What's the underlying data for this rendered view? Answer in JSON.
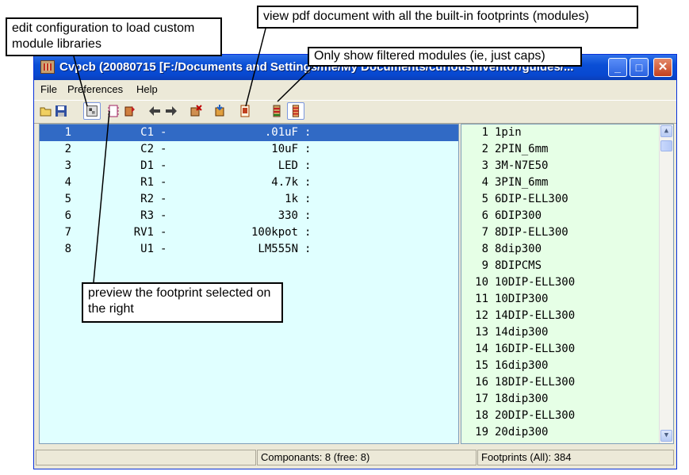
{
  "window": {
    "title": "Cvpcb (20080715 [F:/Documents and Settings/me/My Documents/curiousinventor/guides/..."
  },
  "menu": [
    "File",
    "Preferences",
    "Help"
  ],
  "toolbar": {
    "icons": [
      "open-icon",
      "save-icon",
      "config-icon",
      "preview-footprint-icon",
      "auto-associate-icon",
      "previous-icon",
      "next-icon",
      "delete-associations-icon",
      "export-icon",
      "pdf-doc-icon",
      "show-filtered-icon",
      "show-all-icon"
    ]
  },
  "components": [
    {
      "index": "1",
      "ref": "C1",
      "value": ".01uF",
      "selected": true
    },
    {
      "index": "2",
      "ref": "C2",
      "value": "10uF"
    },
    {
      "index": "3",
      "ref": "D1",
      "value": "LED"
    },
    {
      "index": "4",
      "ref": "R1",
      "value": "4.7k"
    },
    {
      "index": "5",
      "ref": "R2",
      "value": "1k"
    },
    {
      "index": "6",
      "ref": "R3",
      "value": "330"
    },
    {
      "index": "7",
      "ref": "RV1",
      "value": "100kpot"
    },
    {
      "index": "8",
      "ref": "U1",
      "value": "LM555N"
    }
  ],
  "footprints": [
    {
      "index": "1",
      "name": "1pin"
    },
    {
      "index": "2",
      "name": "2PIN_6mm"
    },
    {
      "index": "3",
      "name": "3M-N7E50"
    },
    {
      "index": "4",
      "name": "3PIN_6mm"
    },
    {
      "index": "5",
      "name": "6DIP-ELL300"
    },
    {
      "index": "6",
      "name": "6DIP300"
    },
    {
      "index": "7",
      "name": "8DIP-ELL300"
    },
    {
      "index": "8",
      "name": "8dip300"
    },
    {
      "index": "9",
      "name": "8DIPCMS"
    },
    {
      "index": "10",
      "name": "10DIP-ELL300"
    },
    {
      "index": "11",
      "name": "10DIP300"
    },
    {
      "index": "12",
      "name": "14DIP-ELL300"
    },
    {
      "index": "13",
      "name": "14dip300"
    },
    {
      "index": "14",
      "name": "16DIP-ELL300"
    },
    {
      "index": "15",
      "name": "16dip300"
    },
    {
      "index": "16",
      "name": "18DIP-ELL300"
    },
    {
      "index": "17",
      "name": "18dip300"
    },
    {
      "index": "18",
      "name": "20DIP-ELL300"
    },
    {
      "index": "19",
      "name": "20dip300"
    }
  ],
  "status": {
    "components": "Componants: 8 (free: 8)",
    "footprints": "Footprints (All): 384"
  },
  "callouts": {
    "config": "edit configuration to load custom module libraries",
    "pdf": "view pdf document with all the built-in footprints (modules)",
    "filter": "Only show filtered modules (ie, just caps)",
    "preview": "preview the footprint selected on the right"
  },
  "colors": {
    "titlebar": "#0a4fd6",
    "component_list_bg": "#e0ffff",
    "footprint_list_bg": "#e6ffe6",
    "selection": "#316ac5"
  }
}
